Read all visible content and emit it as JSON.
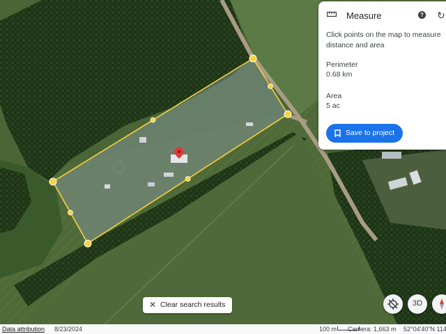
{
  "measure_panel": {
    "title": "Measure",
    "instruction": "Click points on the map to measure distance and area",
    "perimeter_label": "Perimeter",
    "perimeter_value": "0.68 km",
    "area_label": "Area",
    "area_value": "5 ac",
    "save_label": "Save to project",
    "icons": [
      "ruler-icon",
      "help-icon",
      "refresh-icon",
      "bookmark-icon"
    ]
  },
  "map": {
    "clear_search_label": "Clear search results",
    "buttons": [
      "pin-slash-icon",
      "3d",
      "compass-icon"
    ],
    "three_d_label": "3D",
    "colors": {
      "measure_outline": "#f9d33a",
      "save_button": "#1a73e8",
      "pin": "#e53935"
    }
  },
  "status_bar": {
    "attribution": "Data attribution",
    "date": "8/23/2024",
    "scale": "100 m",
    "camera": "Camera: 1,663 m",
    "coordinates": "52°04'40\"N 114"
  }
}
